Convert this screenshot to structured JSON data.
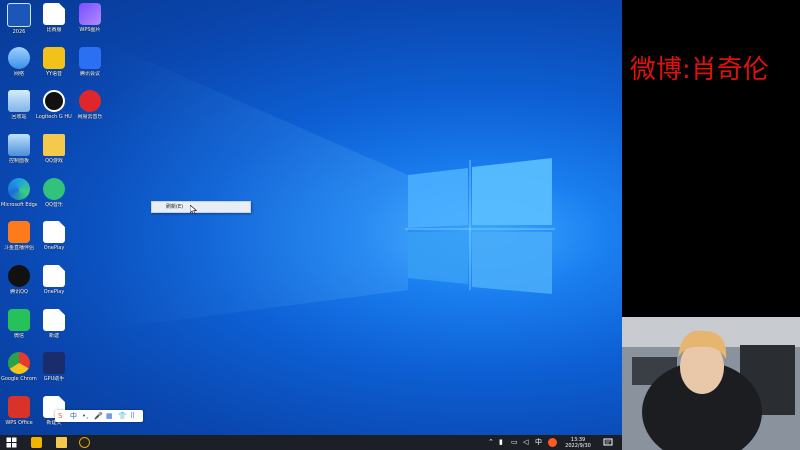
{
  "desktop": {
    "icons": [
      {
        "label": "2026",
        "kind": "logo"
      },
      {
        "label": "比赛服",
        "kind": "doc"
      },
      {
        "label": "WPS图片",
        "kind": "wps-pic"
      },
      {
        "label": "网络",
        "kind": "network"
      },
      {
        "label": "YY语音",
        "kind": "yy"
      },
      {
        "label": "腾讯会议",
        "kind": "meeting"
      },
      {
        "label": "回收站",
        "kind": "recycle"
      },
      {
        "label": "Logitech G HUB",
        "kind": "ghub"
      },
      {
        "label": "网易云音乐",
        "kind": "netease"
      },
      {
        "label": "控制面板",
        "kind": "control"
      },
      {
        "label": "QQ游戏",
        "kind": "folder"
      },
      {
        "label": "Microsoft Edge",
        "kind": "edge"
      },
      {
        "label": "QQ音乐",
        "kind": "qqmusic"
      },
      {
        "label": "斗鱼直播伴侣",
        "kind": "douyu"
      },
      {
        "label": "OnePlay",
        "kind": "doc"
      },
      {
        "label": "腾讯QQ",
        "kind": "qq"
      },
      {
        "label": "OnePlay",
        "kind": "doc"
      },
      {
        "label": "微信",
        "kind": "wechat"
      },
      {
        "label": "新建",
        "kind": "doc"
      },
      {
        "label": "Google Chrome",
        "kind": "chrome"
      },
      {
        "label": "GPU助手",
        "kind": "gpu"
      },
      {
        "label": "WPS Office",
        "kind": "wps"
      },
      {
        "label": "新建文",
        "kind": "doc"
      }
    ]
  },
  "context_menu": {
    "item": "刷新(E)"
  },
  "ime_bar": {
    "items": [
      "S",
      "中",
      "•,",
      "🎤",
      "▦",
      "👕",
      "⠿"
    ]
  },
  "taskbar": {
    "time": "13:39",
    "date": "2022/9/30",
    "tray_ime": "中"
  },
  "stream": {
    "weibo_text": "微博:肖奇伦"
  },
  "colors": {
    "accent_red": "#e01010",
    "desktop_blue": "#0d5fd3"
  }
}
